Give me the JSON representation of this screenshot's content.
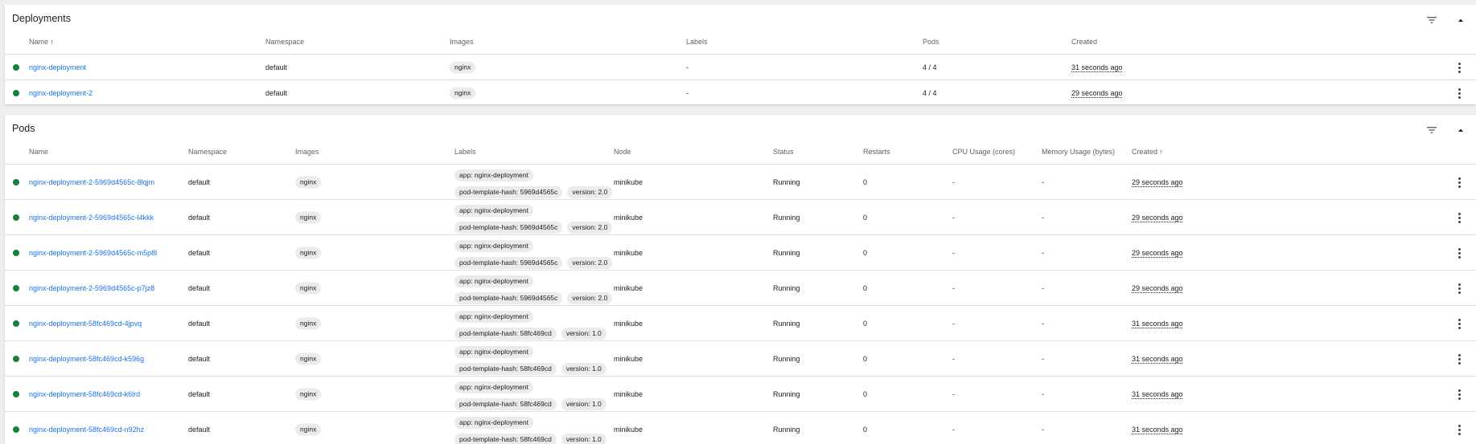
{
  "colors": {
    "status_ok": "#188038",
    "link": "#1a73e8"
  },
  "deployments": {
    "title": "Deployments",
    "icons": {
      "filter": "filter-list-icon",
      "collapse": "chevron-up-icon"
    },
    "columns": {
      "name": "Name",
      "namespace": "Namespace",
      "images": "Images",
      "labels": "Labels",
      "pods": "Pods",
      "created": "Created"
    },
    "sort": {
      "column": "Name",
      "direction": "ascending"
    },
    "rows": [
      {
        "name": "nginx-deployment",
        "namespace": "default",
        "image": "nginx",
        "labels": "-",
        "pods": "4 / 4",
        "created": "31 seconds ago",
        "status": "ok"
      },
      {
        "name": "nginx-deployment-2",
        "namespace": "default",
        "image": "nginx",
        "labels": "-",
        "pods": "4 / 4",
        "created": "29 seconds ago",
        "status": "ok"
      }
    ]
  },
  "pods": {
    "title": "Pods",
    "icons": {
      "filter": "filter-list-icon",
      "collapse": "chevron-up-icon"
    },
    "columns": {
      "name": "Name",
      "namespace": "Namespace",
      "images": "Images",
      "labels": "Labels",
      "node": "Node",
      "status": "Status",
      "restarts": "Restarts",
      "cpu": "CPU Usage (cores)",
      "memory": "Memory Usage (bytes)",
      "created": "Created"
    },
    "sort": {
      "column": "Created",
      "direction": "ascending"
    },
    "rows": [
      {
        "name": "nginx-deployment-2-5969d4565c-8lqjm",
        "namespace": "default",
        "image": "nginx",
        "label_app": "app: nginx-deployment",
        "label_hash": "pod-template-hash: 5969d4565c",
        "label_version": "version: 2.0",
        "node": "minikube",
        "status": "Running",
        "restarts": "0",
        "cpu": "-",
        "memory": "-",
        "created": "29 seconds ago"
      },
      {
        "name": "nginx-deployment-2-5969d4565c-l4kkk",
        "namespace": "default",
        "image": "nginx",
        "label_app": "app: nginx-deployment",
        "label_hash": "pod-template-hash: 5969d4565c",
        "label_version": "version: 2.0",
        "node": "minikube",
        "status": "Running",
        "restarts": "0",
        "cpu": "-",
        "memory": "-",
        "created": "29 seconds ago"
      },
      {
        "name": "nginx-deployment-2-5969d4565c-m5p8l",
        "namespace": "default",
        "image": "nginx",
        "label_app": "app: nginx-deployment",
        "label_hash": "pod-template-hash: 5969d4565c",
        "label_version": "version: 2.0",
        "node": "minikube",
        "status": "Running",
        "restarts": "0",
        "cpu": "-",
        "memory": "-",
        "created": "29 seconds ago"
      },
      {
        "name": "nginx-deployment-2-5969d4565c-p7jz8",
        "namespace": "default",
        "image": "nginx",
        "label_app": "app: nginx-deployment",
        "label_hash": "pod-template-hash: 5969d4565c",
        "label_version": "version: 2.0",
        "node": "minikube",
        "status": "Running",
        "restarts": "0",
        "cpu": "-",
        "memory": "-",
        "created": "29 seconds ago"
      },
      {
        "name": "nginx-deployment-58fc469cd-4jpvq",
        "namespace": "default",
        "image": "nginx",
        "label_app": "app: nginx-deployment",
        "label_hash": "pod-template-hash: 58fc469cd",
        "label_version": "version: 1.0",
        "node": "minikube",
        "status": "Running",
        "restarts": "0",
        "cpu": "-",
        "memory": "-",
        "created": "31 seconds ago"
      },
      {
        "name": "nginx-deployment-58fc469cd-k596g",
        "namespace": "default",
        "image": "nginx",
        "label_app": "app: nginx-deployment",
        "label_hash": "pod-template-hash: 58fc469cd",
        "label_version": "version: 1.0",
        "node": "minikube",
        "status": "Running",
        "restarts": "0",
        "cpu": "-",
        "memory": "-",
        "created": "31 seconds ago"
      },
      {
        "name": "nginx-deployment-58fc469cd-k6lrd",
        "namespace": "default",
        "image": "nginx",
        "label_app": "app: nginx-deployment",
        "label_hash": "pod-template-hash: 58fc469cd",
        "label_version": "version: 1.0",
        "node": "minikube",
        "status": "Running",
        "restarts": "0",
        "cpu": "-",
        "memory": "-",
        "created": "31 seconds ago"
      },
      {
        "name": "nginx-deployment-58fc469cd-n92hz",
        "namespace": "default",
        "image": "nginx",
        "label_app": "app: nginx-deployment",
        "label_hash": "pod-template-hash: 58fc469cd",
        "label_version": "version: 1.0",
        "node": "minikube",
        "status": "Running",
        "restarts": "0",
        "cpu": "-",
        "memory": "-",
        "created": "31 seconds ago"
      }
    ]
  }
}
